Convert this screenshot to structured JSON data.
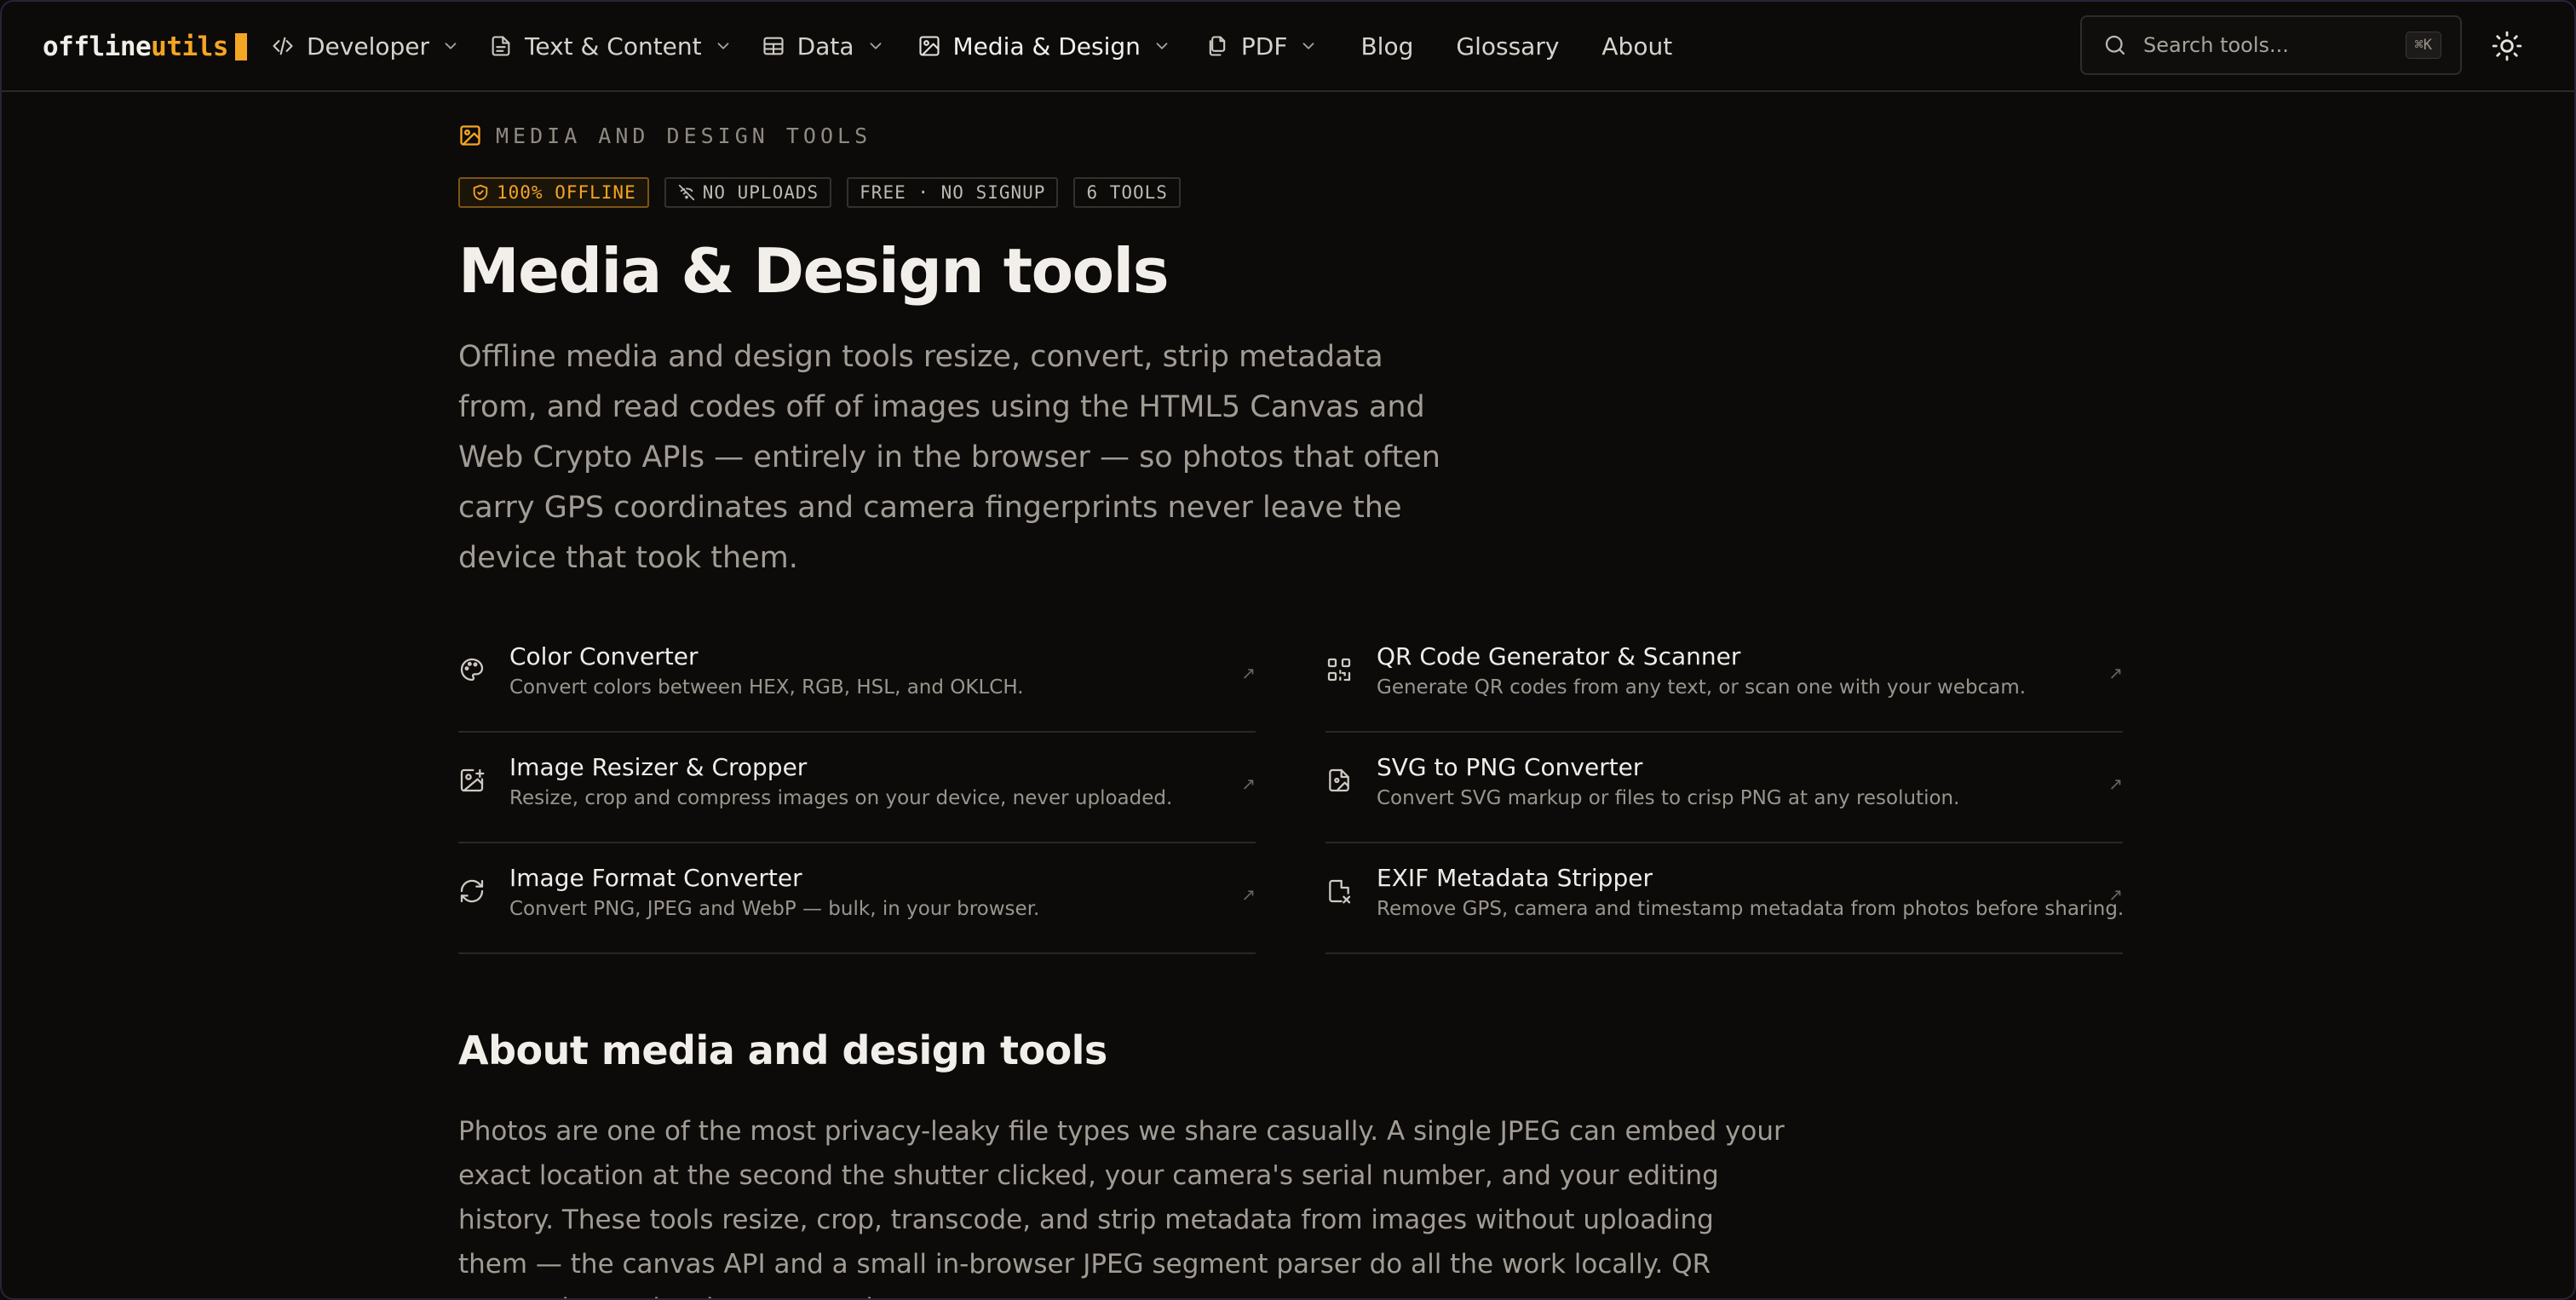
{
  "header": {
    "logo": {
      "part1": "offline",
      "part2": "utils"
    },
    "nav": [
      {
        "label": "Developer",
        "icon": "code-icon",
        "dropdown": true
      },
      {
        "label": "Text & Content",
        "icon": "document-icon",
        "dropdown": true
      },
      {
        "label": "Data",
        "icon": "table-icon",
        "dropdown": true
      },
      {
        "label": "Media & Design",
        "icon": "image-icon",
        "dropdown": true,
        "active": true
      },
      {
        "label": "PDF",
        "icon": "files-icon",
        "dropdown": true
      },
      {
        "label": "Blog"
      },
      {
        "label": "Glossary"
      },
      {
        "label": "About"
      }
    ],
    "search": {
      "placeholder": "Search tools...",
      "shortcut": "⌘K"
    },
    "theme_toggle_icon": "sun-icon"
  },
  "hero": {
    "eyebrow": "MEDIA AND DESIGN TOOLS",
    "badges": [
      "100% OFFLINE",
      "NO UPLOADS",
      "FREE · NO SIGNUP",
      "6 TOOLS"
    ],
    "title": "Media & Design tools",
    "lead": "Offline media and design tools resize, convert, strip metadata from, and read codes off of images using the HTML5 Canvas and Web Crypto APIs — entirely in the browser — so photos that often carry GPS coordinates and camera fingerprints never leave the device that took them."
  },
  "tools": [
    {
      "name": "Color Converter",
      "desc": "Convert colors between HEX, RGB, HSL, and OKLCH.",
      "icon": "palette-icon"
    },
    {
      "name": "QR Code Generator & Scanner",
      "desc": "Generate QR codes from any text, or scan one with your webcam.",
      "icon": "qr-code-icon"
    },
    {
      "name": "Image Resizer & Cropper",
      "desc": "Resize, crop and compress images on your device, never uploaded.",
      "icon": "image-plus-icon"
    },
    {
      "name": "SVG to PNG Converter",
      "desc": "Convert SVG markup or files to crisp PNG at any resolution.",
      "icon": "file-image-icon"
    },
    {
      "name": "Image Format Converter",
      "desc": "Convert PNG, JPEG and WebP — bulk, in your browser.",
      "icon": "refresh-icon"
    },
    {
      "name": "EXIF Metadata Stripper",
      "desc": "Remove GPS, camera and timestamp metadata from photos before sharing.",
      "icon": "file-x-icon"
    }
  ],
  "about": {
    "title": "About media and design tools",
    "body": "Photos are one of the most privacy-leaky file types we share casually. A single JPEG can embed your exact location at the second the shutter clicked, your camera's serial number, and your editing history. These tools resize, crop, transcode, and strip metadata from images without uploading them — the canvas API and a small in-browser JPEG segment parser do all the work locally. QR generation and webcam scanning"
  },
  "colors": {
    "accent": "#f5a524",
    "background": "#0c0b0a"
  }
}
